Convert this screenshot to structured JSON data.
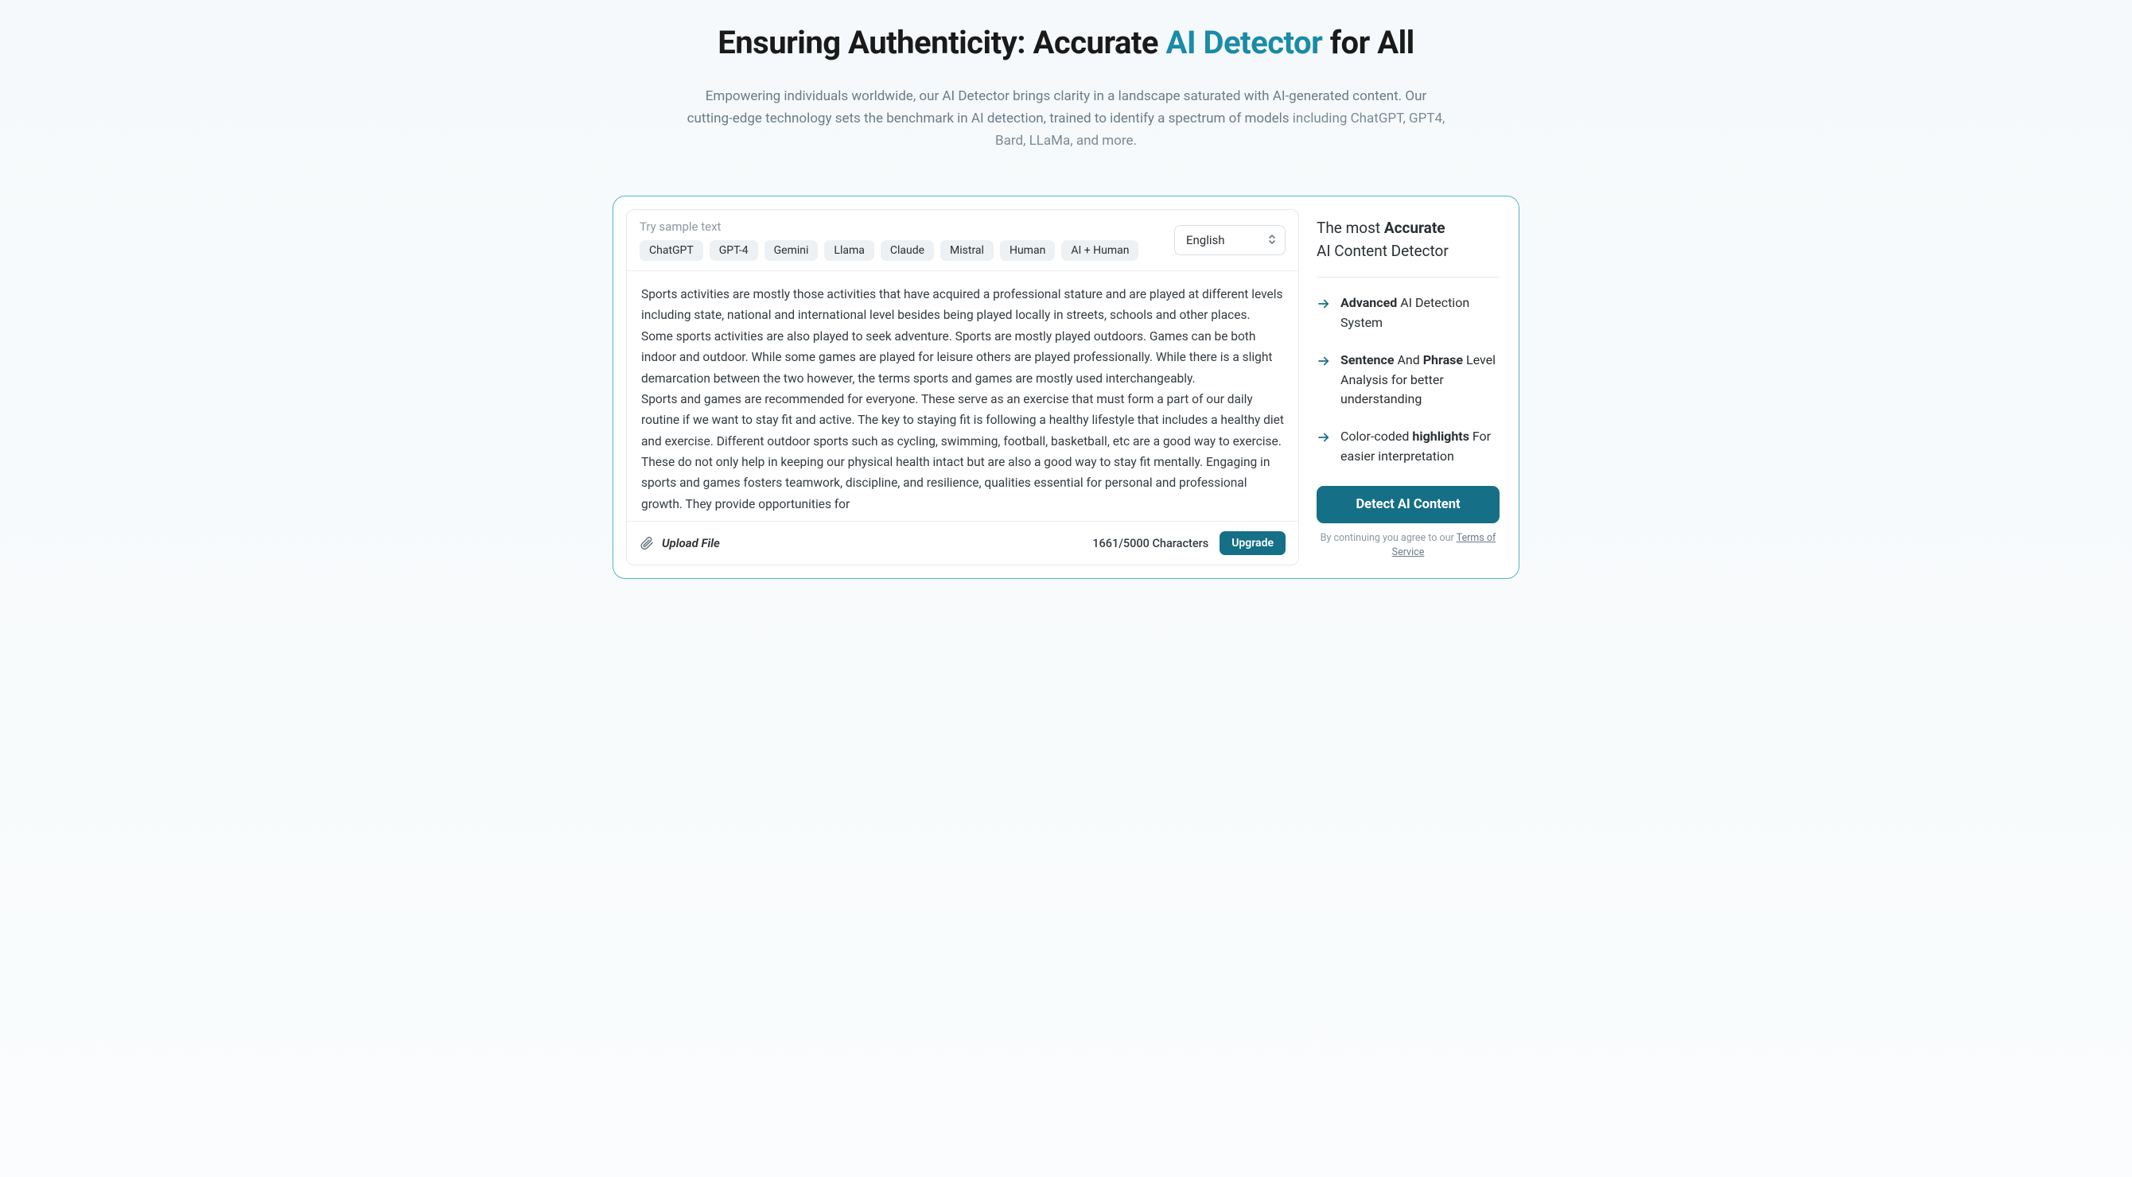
{
  "hero": {
    "title_pre": "Ensuring Authenticity: Accurate ",
    "title_accent": "AI Detector",
    "title_post": " for All",
    "subtitle_main": "Empowering individuals worldwide, our AI Detector brings clarity in a landscape saturated with AI-generated content. Our cutting-edge technology sets the benchmark in AI detection, trained to identify a spectrum of models ",
    "subtitle_models": "including ChatGPT, GPT4, Bard, LLaMa, and more."
  },
  "editor": {
    "sample_label": "Try sample text",
    "chips": [
      "ChatGPT",
      "GPT-4",
      "Gemini",
      "Llama",
      "Claude",
      "Mistral",
      "Human",
      "AI + Human"
    ],
    "language_selected": "English",
    "text": "Sports activities are mostly those activities that have acquired a professional stature and are played at different levels including state, national and international level besides being played locally in streets, schools and other places. Some sports activities are also played to seek adventure. Sports are mostly played outdoors. Games can be both indoor and outdoor. While some games are played for leisure others are played professionally. While there is a slight demarcation between the two however, the terms sports and games are mostly used interchangeably.\nSports and games are recommended for everyone. These serve as an exercise that must form a part of our daily routine if we want to stay fit and active. The key to staying fit is following a healthy lifestyle that includes a healthy diet and exercise. Different outdoor sports such as cycling, swimming, football, basketball, etc are a good way to exercise. These do not only help in keeping our physical health intact but are also a good way to stay fit mentally. Engaging in sports and games fosters teamwork, discipline, and resilience, qualities essential for personal and professional growth. They provide opportunities for",
    "upload_label": "Upload File",
    "char_count": "1661/5000 Characters",
    "upgrade_label": "Upgrade"
  },
  "sidebar": {
    "title_pre": "The most ",
    "title_bold": "Accurate",
    "title_line2": "AI Content Detector",
    "features": [
      {
        "html": "<span class='b'>Advanced</span> AI Detection System"
      },
      {
        "html": "<span class='b'>Sentence</span> And <span class='b'>Phrase</span> Level Analysis for better understanding"
      },
      {
        "html": "Color-coded <span class='b'>highlights</span> For easier interpretation"
      }
    ],
    "detect_label": "Detect AI Content",
    "tos_pre": "By continuing you agree to our ",
    "tos_link": "Terms of Service"
  }
}
